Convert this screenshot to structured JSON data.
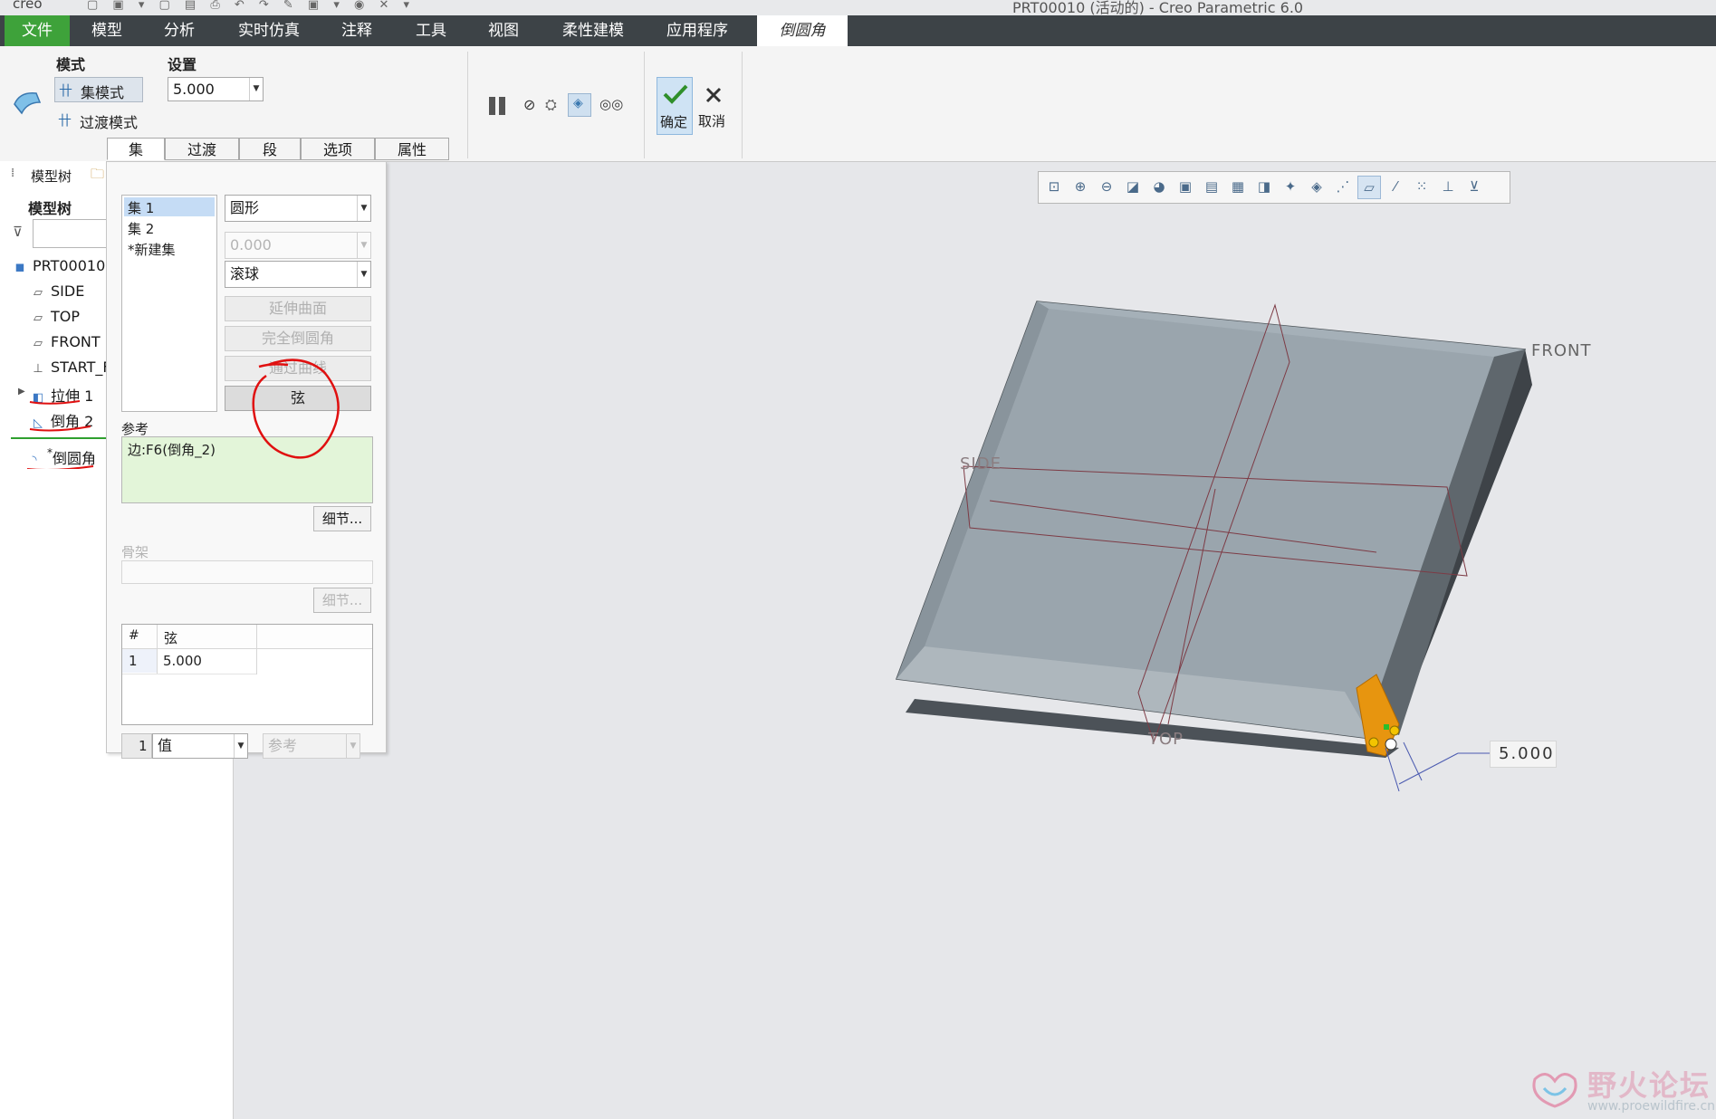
{
  "window": {
    "logo": "creo",
    "title": "PRT00010 (活动的) - Creo Parametric 6.0"
  },
  "menu": {
    "file": "文件",
    "items": [
      "模型",
      "分析",
      "实时仿真",
      "注释",
      "工具",
      "视图",
      "柔性建模",
      "应用程序"
    ],
    "active": "倒圆角"
  },
  "ribbon": {
    "mode_header": "模式",
    "set_mode": "集模式",
    "transition_mode": "过渡模式",
    "settings_header": "设置",
    "settings_value": "5.000",
    "ok_label": "确定",
    "cancel_label": "取消",
    "tabs": [
      "集",
      "过渡",
      "段",
      "选项",
      "属性"
    ],
    "active_tab": "集"
  },
  "sidebar": {
    "tab_label": "模型树",
    "header": "模型树",
    "items": [
      {
        "label": "PRT00010.I",
        "icon": "part-icon"
      },
      {
        "label": "SIDE",
        "icon": "datum-plane-icon"
      },
      {
        "label": "TOP",
        "icon": "datum-plane-icon"
      },
      {
        "label": "FRONT",
        "icon": "datum-plane-icon"
      },
      {
        "label": "START_F",
        "icon": "csys-icon"
      },
      {
        "label": "拉伸 1",
        "icon": "extrude-icon"
      },
      {
        "label": "倒角 2",
        "icon": "chamfer-icon"
      },
      {
        "label": "倒圆角",
        "prefix": "*",
        "icon": "round-icon"
      }
    ]
  },
  "panel": {
    "sets": [
      "集 1",
      "集 2",
      "*新建集"
    ],
    "shape": "圆形",
    "value_disabled": "0.000",
    "method": "滚球",
    "buttons": [
      "延伸曲面",
      "完全倒圆角",
      "通过曲线",
      "弦"
    ],
    "reference_label": "参考",
    "reference_value": "边:F6(倒角_2)",
    "details_label": "细节...",
    "skeleton_label": "骨架",
    "skeleton_details": "细节...",
    "table": {
      "headers": [
        "#",
        "弦"
      ],
      "rows": [
        [
          "1",
          "5.000"
        ]
      ]
    },
    "footer_index": "1",
    "footer_value": "值",
    "footer_ref": "参考"
  },
  "viewport": {
    "dimension": "5.000",
    "plane_labels": [
      "FRONT",
      "SIDE",
      "TOP"
    ]
  },
  "watermark": {
    "name": "野火论坛",
    "url": "www.proewildfire.cn"
  },
  "colors": {
    "menubar": "#3d4347",
    "file_tab": "#3ea23a",
    "selection": "#c5dcf5",
    "reference_bg": "#e3f5d9",
    "highlight": "#e7950f",
    "annotation": "#e01010"
  }
}
